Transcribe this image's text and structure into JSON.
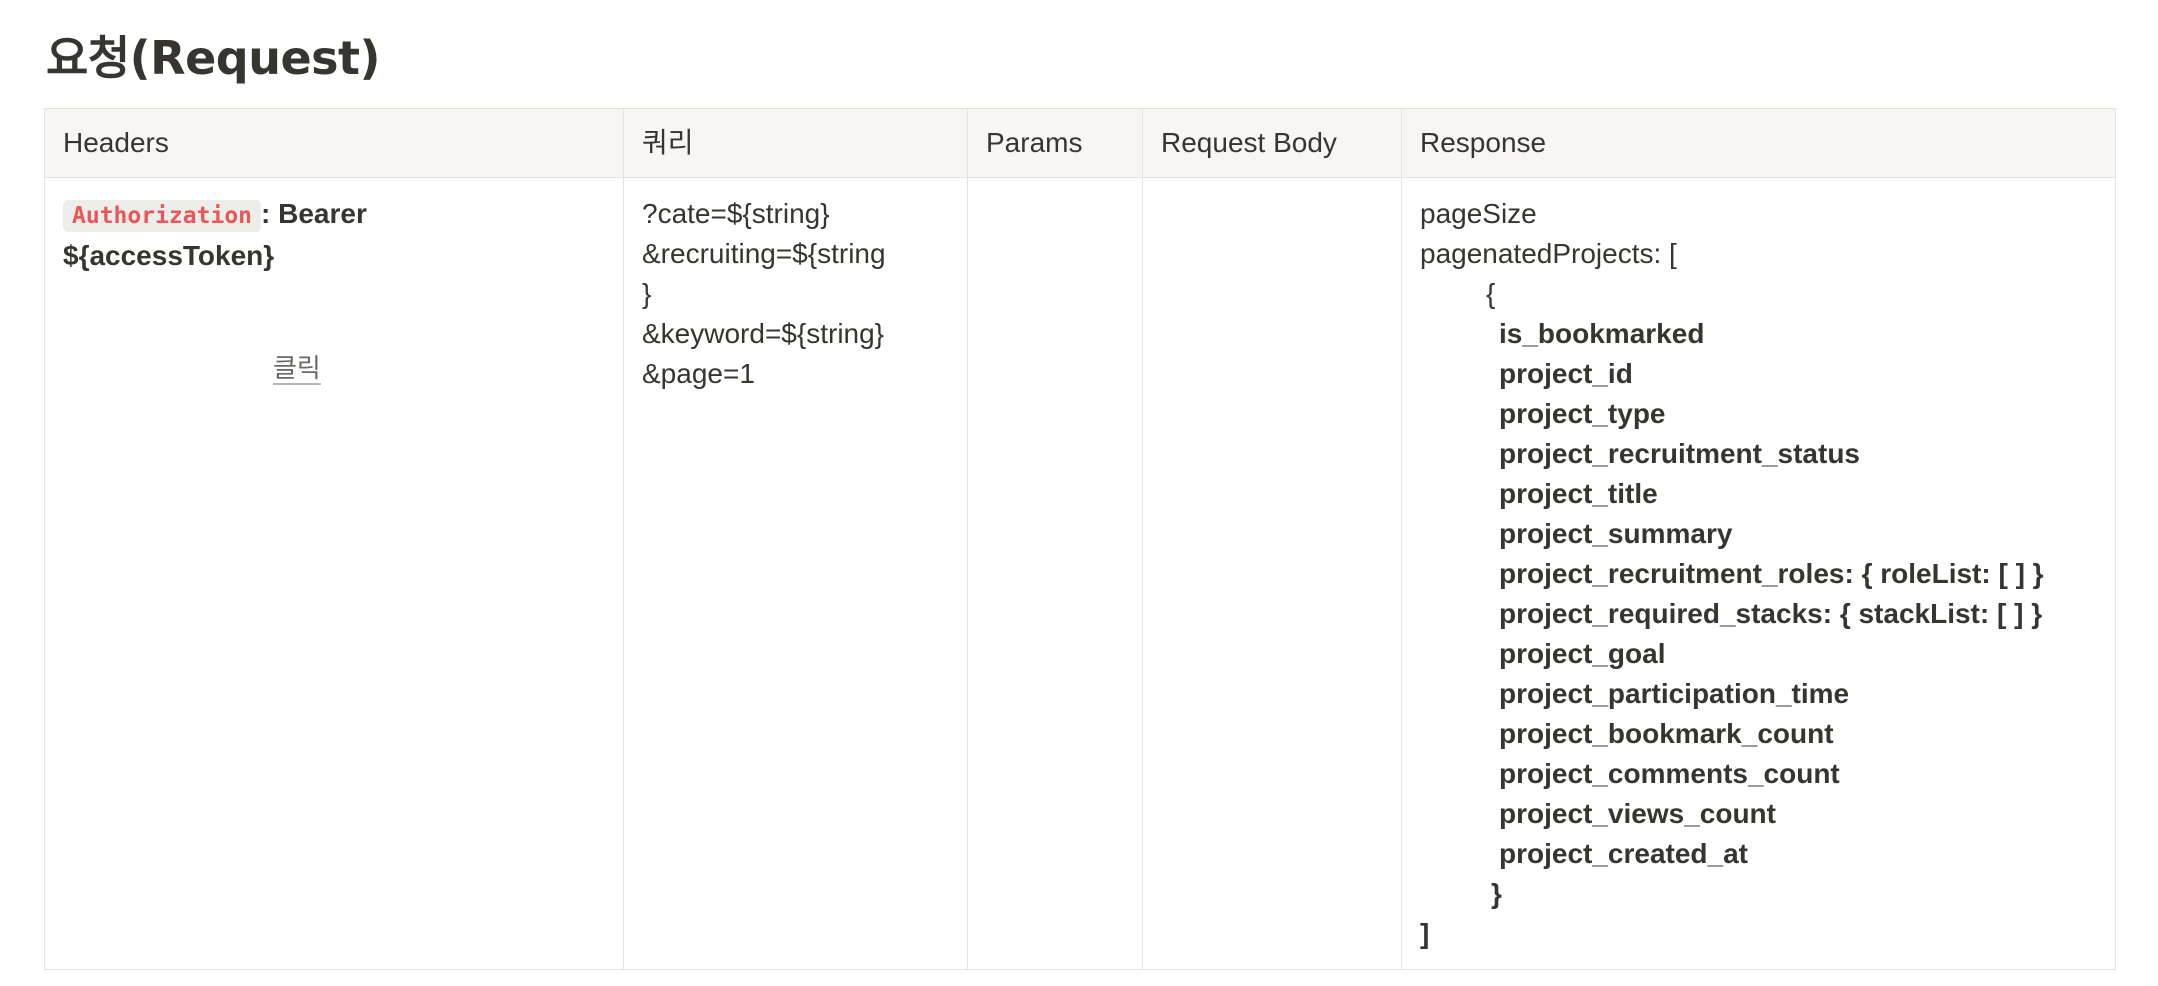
{
  "page": {
    "title": "요청(Request)"
  },
  "table": {
    "headers": [
      "Headers",
      "쿼리",
      "Params",
      "Request Body",
      "Response"
    ],
    "headers_cell": {
      "auth_key": "Authorization",
      "auth_value_line1": ": Bearer",
      "auth_value_line2": "${accessToken}",
      "click_label": "클릭"
    },
    "query_lines": [
      "?cate=${string}",
      "&recruiting=${string",
      "}",
      "&keyword=${string}",
      "&page=1"
    ],
    "params_cell": "",
    "request_body_cell": "",
    "response": {
      "page_size": "pageSize",
      "paginated_open": "pagenatedProjects: [",
      "object_open": "{",
      "fields": [
        "is_bookmarked",
        "project_id",
        "project_type",
        "project_recruitment_status",
        "project_title",
        "project_summary",
        "project_recruitment_roles: { roleList: [ ] }",
        "project_required_stacks: { stackList: [ ] }",
        "project_goal",
        "project_participation_time",
        "project_bookmark_count",
        "project_comments_count",
        "project_views_count",
        "project_created_at"
      ],
      "object_close": "}",
      "array_close": "]"
    }
  },
  "colors": {
    "text": "#37352f",
    "header_bg": "#f7f6f3",
    "border": "#e4e3e0",
    "code_red": "#eb5757"
  }
}
